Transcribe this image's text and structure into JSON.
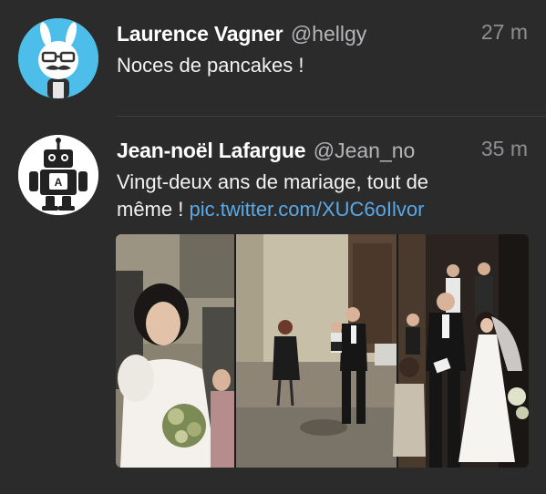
{
  "timeline": {
    "tweets": [
      {
        "display_name": "Laurence Vagner",
        "handle": "@hellgy",
        "timestamp": "27 m",
        "text": "Noces de pancakes !",
        "avatar_icon": "bunny-mustache-glasses-avatar"
      },
      {
        "display_name": "Jean-noël Lafargue",
        "handle": "@Jean_no",
        "timestamp": "35 m",
        "text": "Vingt-deux ans de mariage, tout de même ! ",
        "link": "pic.twitter.com/XUC6oIlvor",
        "avatar_icon": "robot-avatar",
        "media_icon": "wedding-photos-collage"
      }
    ]
  },
  "colors": {
    "background": "#2b2b2c",
    "name": "#ffffff",
    "handle": "#b5b5b8",
    "timestamp": "#8f8f93",
    "link": "#5aa9e6",
    "divider": "#3d3d3f"
  }
}
